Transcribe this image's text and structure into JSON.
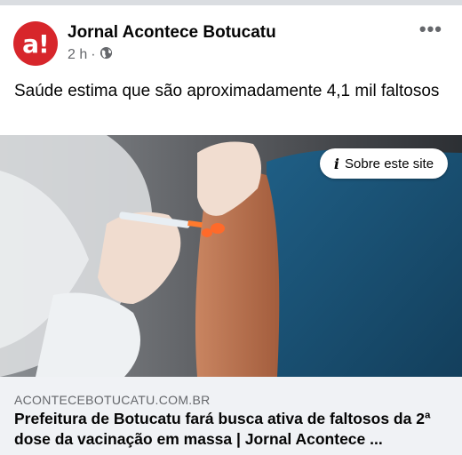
{
  "post": {
    "page_name": "Jornal Acontece Botucatu",
    "avatar_text": "a!",
    "time": "2 h",
    "separator": "·",
    "privacy_icon": "globe-icon",
    "more_icon": "more-horizontal-icon",
    "text": "Saúde estima que são aproximadamente 4,1 mil faltosos"
  },
  "media": {
    "sobre_button": {
      "icon": "info-icon",
      "icon_glyph": "i",
      "label": "Sobre este site"
    }
  },
  "link": {
    "domain": "ACONTECEBOTUCATU.COM.BR",
    "title": "Prefeitura de Botucatu fará busca ativa de faltosos da 2ª dose da vacinação em massa | Jornal Acontece ..."
  },
  "colors": {
    "brand": "#d7262b",
    "muted_text": "#65676b",
    "link_bg": "#f0f2f5"
  }
}
